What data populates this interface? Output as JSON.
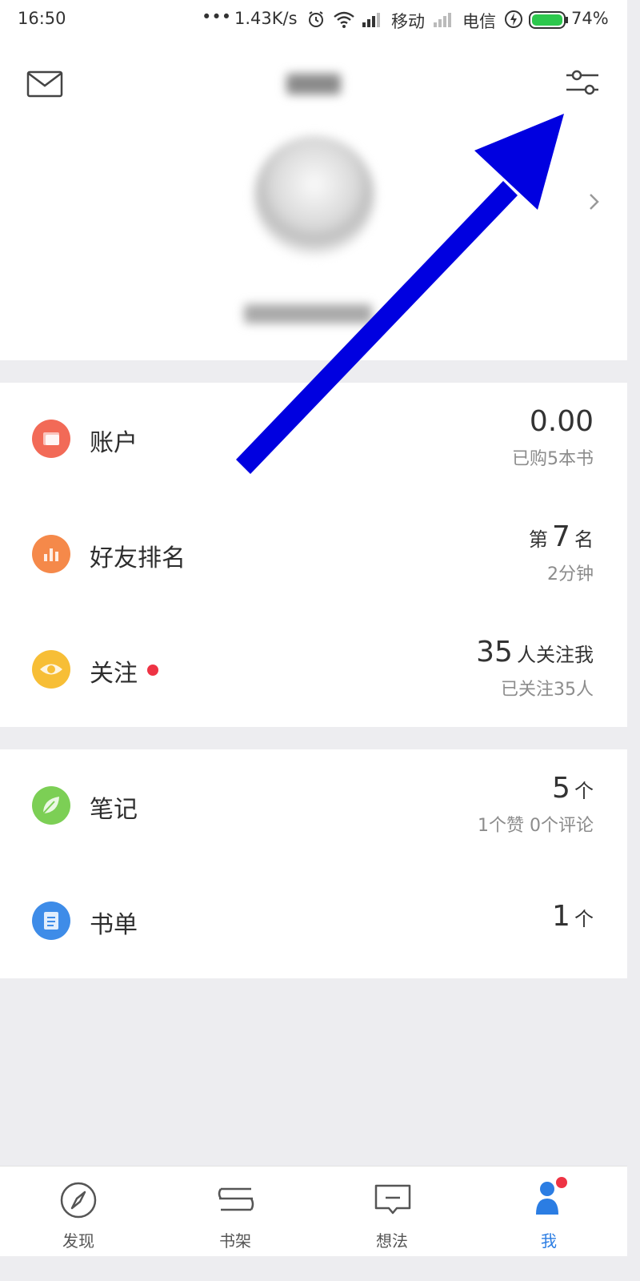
{
  "status_bar": {
    "time": "16:50",
    "dots": "•••",
    "speed": "1.43K/s",
    "carrier1": "移动",
    "carrier2": "电信",
    "battery": "74%"
  },
  "header": {
    "mail_icon": "mail-icon",
    "filter_icon": "settings-sliders-icon",
    "chevron_icon": "chevron-right-icon"
  },
  "sections": {
    "account": {
      "label": "账户",
      "value": "0.00",
      "sub": "已购5本书",
      "icon_color": "#f26a57"
    },
    "ranking": {
      "label": "好友排名",
      "prefix": "第",
      "value": "7",
      "suffix": "名",
      "sub": "2分钟",
      "icon_color": "#f5894a"
    },
    "follow": {
      "label": "关注",
      "value": "35",
      "suffix": "人关注我",
      "sub": "已关注35人",
      "icon_color": "#f7be36",
      "badge_color": "#ee3344"
    },
    "notes": {
      "label": "笔记",
      "value": "5",
      "suffix": "个",
      "sub": "1个赞 0个评论",
      "icon_color": "#7ccf55"
    },
    "booklist": {
      "label": "书单",
      "value": "1",
      "suffix": "个",
      "icon_color": "#3e8ce8"
    }
  },
  "tabbar": {
    "tabs": [
      {
        "label": "发现",
        "icon": "compass-icon"
      },
      {
        "label": "书架",
        "icon": "bookshelf-icon"
      },
      {
        "label": "想法",
        "icon": "comment-icon"
      },
      {
        "label": "我",
        "icon": "person-icon",
        "active": true
      }
    ]
  },
  "annotation": {
    "arrow_color": "#0000e0"
  }
}
